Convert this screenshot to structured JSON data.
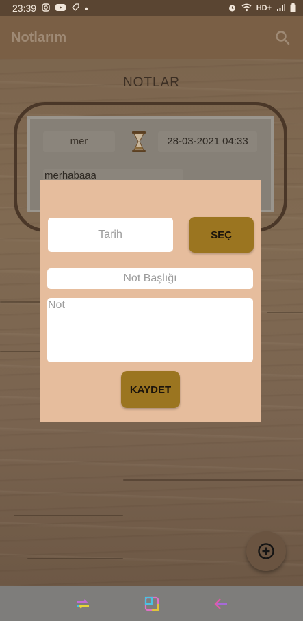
{
  "status_bar": {
    "time": "23:39",
    "dot": "•",
    "network": "HD+"
  },
  "app_bar": {
    "title": "Notlarım"
  },
  "section": {
    "title": "NOTLAR"
  },
  "note_card": {
    "category": "mer",
    "date": "28-03-2021 04:33",
    "text": "merhabaaa"
  },
  "dialog": {
    "date_placeholder": "Tarih",
    "pick_button": "SEÇ",
    "title_placeholder": "Not Başlığı",
    "note_placeholder": "Not",
    "save_button": "KAYDET"
  },
  "colors": {
    "dialog_bg": "#e6bd9d",
    "button_gold": "#9b7520",
    "app_bar": "#7a5f45"
  }
}
